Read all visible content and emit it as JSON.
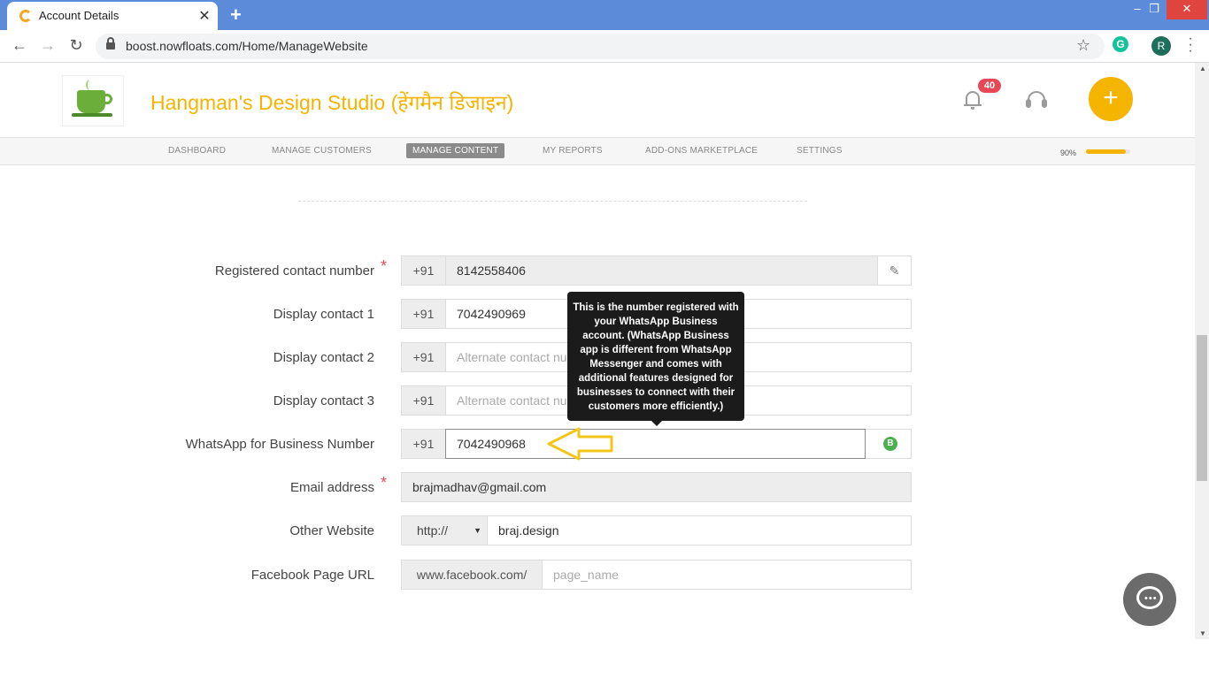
{
  "browser": {
    "tab_title": "Account Details",
    "tab_close": "✕",
    "new_tab": "+",
    "url": "boost.nowfloats.com/Home/ManageWebsite",
    "profile_initial": "R",
    "extension_label": "G",
    "win_min": "–",
    "win_max": "❐",
    "win_close": "✕"
  },
  "header": {
    "site_title": "Hangman's Design Studio (हेंगमैन डिजाइन)",
    "notification_count": "40",
    "add_label": "+"
  },
  "nav": {
    "items": [
      "DASHBOARD",
      "MANAGE CUSTOMERS",
      "MANAGE CONTENT",
      "MY REPORTS",
      "ADD-ONS MARKETPLACE",
      "SETTINGS"
    ],
    "active": "MANAGE CONTENT",
    "progress_label": "90%",
    "progress_value": 0.9
  },
  "form": {
    "registered": {
      "label": "Registered contact number",
      "required": "*",
      "prefix": "+91",
      "value": "8142558406"
    },
    "display1": {
      "label": "Display contact 1",
      "prefix": "+91",
      "value": "7042490969"
    },
    "display2": {
      "label": "Display contact 2",
      "prefix": "+91",
      "placeholder": "Alternate contact number"
    },
    "display3": {
      "label": "Display contact 3",
      "prefix": "+91",
      "placeholder": "Alternate contact number"
    },
    "whatsapp": {
      "label": "WhatsApp for Business Number",
      "prefix": "+91",
      "value": "7042490968",
      "icon_letter": "B"
    },
    "email": {
      "label": "Email address",
      "required": "*",
      "value": "brajmadhav@gmail.com"
    },
    "website": {
      "label": "Other Website",
      "protocol": "http://",
      "value": "braj.design"
    },
    "facebook": {
      "label": "Facebook Page URL",
      "prefix": "www.facebook.com/",
      "placeholder": "page_name"
    }
  },
  "tooltip": {
    "text": "This is the number registered with your WhatsApp Business account. (WhatsApp Business app is different from WhatsApp Messenger and comes with additional features designed for businesses to connect with their customers more efficiently.)"
  },
  "colors": {
    "brand": "#f5b400",
    "tabbar": "#5b8bd9",
    "badge": "#e84855",
    "whatsapp_business": "#4caf50"
  }
}
